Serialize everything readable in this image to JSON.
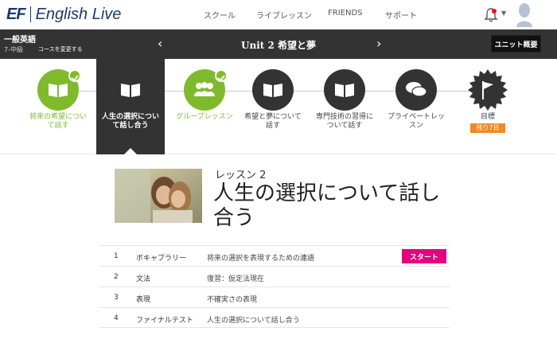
{
  "header": {
    "logo_mark": "EF",
    "logo_text": "English Live",
    "nav": [
      "スクール",
      "ライブレッスン",
      "FRIENDS",
      "サポート"
    ]
  },
  "unit_bar": {
    "course_title": "一般英語",
    "course_level": "7-中級",
    "change_course": "コースを変更する",
    "unit_label": "Unit 2  希望と夢",
    "overview_button": "ユニット概要"
  },
  "lessons": [
    {
      "label": "将来の希望について話す",
      "state": "done",
      "icon": "book-icon"
    },
    {
      "label": "人生の選択について話し合う",
      "state": "active",
      "icon": "book-icon"
    },
    {
      "label": "グループレッスン",
      "state": "done",
      "icon": "group-icon"
    },
    {
      "label": "希望と夢について話す",
      "state": "todo",
      "icon": "book-icon"
    },
    {
      "label": "専門技術の習得について話す",
      "state": "todo",
      "icon": "book-icon"
    },
    {
      "label": "プライベートレッスン",
      "state": "todo",
      "icon": "chat-icon"
    },
    {
      "label": "目標",
      "state": "goal",
      "icon": "flag-icon",
      "badge": "残り7日"
    }
  ],
  "lesson_detail": {
    "number": "レッスン 2",
    "title": "人生の選択について話し合う"
  },
  "activities": [
    {
      "num": "1",
      "type": "ボキャブラリー",
      "desc": "将来の選択を表現するための連語",
      "action": "スタート"
    },
    {
      "num": "2",
      "type": "文法",
      "desc": "復習：仮定法現在"
    },
    {
      "num": "3",
      "type": "表現",
      "desc": "不確実さの表現"
    },
    {
      "num": "4",
      "type": "ファイナルテスト",
      "desc": "人生の選択について話し合う"
    }
  ],
  "colors": {
    "accent_green": "#7fba2c",
    "dark": "#333333",
    "pink": "#e5007e",
    "orange": "#f08a24",
    "brand_blue": "#1a3a6b"
  }
}
